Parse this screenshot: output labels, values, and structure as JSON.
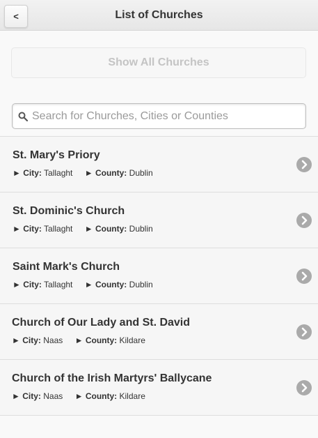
{
  "header": {
    "back_label": "<",
    "title": "List of Churches"
  },
  "show_all": {
    "label": "Show All Churches"
  },
  "search": {
    "placeholder": "Search for Churches, Cities or Counties",
    "value": ""
  },
  "labels": {
    "city": "City:",
    "county": "County:",
    "arrow": "►"
  },
  "churches": [
    {
      "name": "St. Mary's Priory",
      "city": "Tallaght",
      "county": "Dublin"
    },
    {
      "name": "St. Dominic's Church",
      "city": "Tallaght",
      "county": "Dublin"
    },
    {
      "name": "Saint Mark's Church",
      "city": "Tallaght",
      "county": "Dublin"
    },
    {
      "name": "Church of Our Lady and St. David",
      "city": "Naas",
      "county": "Kildare"
    },
    {
      "name": "Church of the Irish Martyrs' Ballycane",
      "city": "Naas",
      "county": "Kildare"
    }
  ],
  "colors": {
    "chevron_bg": "#aaaaaa",
    "muted_text": "#c4c4c4"
  },
  "icons": {
    "search": "search-icon",
    "row_arrow": "chevron-right-icon"
  }
}
